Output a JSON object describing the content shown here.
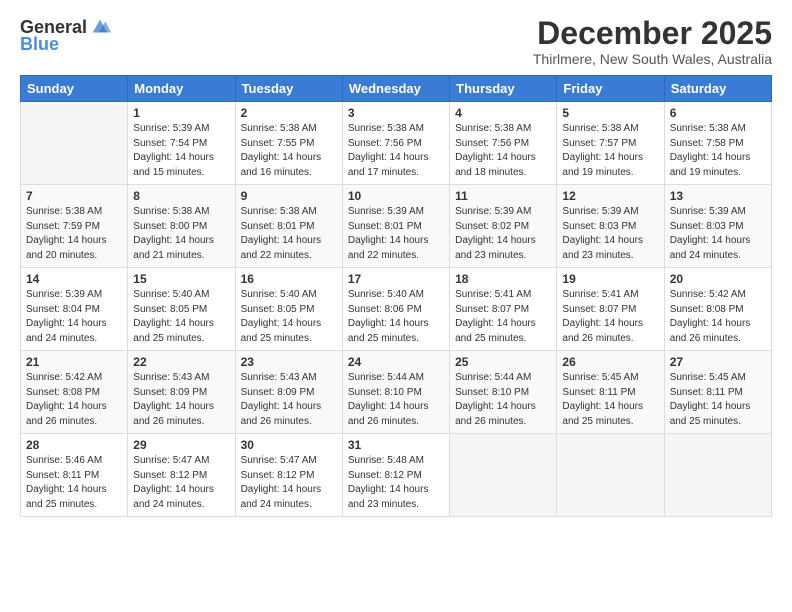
{
  "logo": {
    "general": "General",
    "blue": "Blue"
  },
  "header": {
    "month": "December 2025",
    "location": "Thirlmere, New South Wales, Australia"
  },
  "weekdays": [
    "Sunday",
    "Monday",
    "Tuesday",
    "Wednesday",
    "Thursday",
    "Friday",
    "Saturday"
  ],
  "weeks": [
    [
      {
        "day": "",
        "info": ""
      },
      {
        "day": "1",
        "info": "Sunrise: 5:39 AM\nSunset: 7:54 PM\nDaylight: 14 hours\nand 15 minutes."
      },
      {
        "day": "2",
        "info": "Sunrise: 5:38 AM\nSunset: 7:55 PM\nDaylight: 14 hours\nand 16 minutes."
      },
      {
        "day": "3",
        "info": "Sunrise: 5:38 AM\nSunset: 7:56 PM\nDaylight: 14 hours\nand 17 minutes."
      },
      {
        "day": "4",
        "info": "Sunrise: 5:38 AM\nSunset: 7:56 PM\nDaylight: 14 hours\nand 18 minutes."
      },
      {
        "day": "5",
        "info": "Sunrise: 5:38 AM\nSunset: 7:57 PM\nDaylight: 14 hours\nand 19 minutes."
      },
      {
        "day": "6",
        "info": "Sunrise: 5:38 AM\nSunset: 7:58 PM\nDaylight: 14 hours\nand 19 minutes."
      }
    ],
    [
      {
        "day": "7",
        "info": "Sunrise: 5:38 AM\nSunset: 7:59 PM\nDaylight: 14 hours\nand 20 minutes."
      },
      {
        "day": "8",
        "info": "Sunrise: 5:38 AM\nSunset: 8:00 PM\nDaylight: 14 hours\nand 21 minutes."
      },
      {
        "day": "9",
        "info": "Sunrise: 5:38 AM\nSunset: 8:01 PM\nDaylight: 14 hours\nand 22 minutes."
      },
      {
        "day": "10",
        "info": "Sunrise: 5:39 AM\nSunset: 8:01 PM\nDaylight: 14 hours\nand 22 minutes."
      },
      {
        "day": "11",
        "info": "Sunrise: 5:39 AM\nSunset: 8:02 PM\nDaylight: 14 hours\nand 23 minutes."
      },
      {
        "day": "12",
        "info": "Sunrise: 5:39 AM\nSunset: 8:03 PM\nDaylight: 14 hours\nand 23 minutes."
      },
      {
        "day": "13",
        "info": "Sunrise: 5:39 AM\nSunset: 8:03 PM\nDaylight: 14 hours\nand 24 minutes."
      }
    ],
    [
      {
        "day": "14",
        "info": "Sunrise: 5:39 AM\nSunset: 8:04 PM\nDaylight: 14 hours\nand 24 minutes."
      },
      {
        "day": "15",
        "info": "Sunrise: 5:40 AM\nSunset: 8:05 PM\nDaylight: 14 hours\nand 25 minutes."
      },
      {
        "day": "16",
        "info": "Sunrise: 5:40 AM\nSunset: 8:05 PM\nDaylight: 14 hours\nand 25 minutes."
      },
      {
        "day": "17",
        "info": "Sunrise: 5:40 AM\nSunset: 8:06 PM\nDaylight: 14 hours\nand 25 minutes."
      },
      {
        "day": "18",
        "info": "Sunrise: 5:41 AM\nSunset: 8:07 PM\nDaylight: 14 hours\nand 25 minutes."
      },
      {
        "day": "19",
        "info": "Sunrise: 5:41 AM\nSunset: 8:07 PM\nDaylight: 14 hours\nand 26 minutes."
      },
      {
        "day": "20",
        "info": "Sunrise: 5:42 AM\nSunset: 8:08 PM\nDaylight: 14 hours\nand 26 minutes."
      }
    ],
    [
      {
        "day": "21",
        "info": "Sunrise: 5:42 AM\nSunset: 8:08 PM\nDaylight: 14 hours\nand 26 minutes."
      },
      {
        "day": "22",
        "info": "Sunrise: 5:43 AM\nSunset: 8:09 PM\nDaylight: 14 hours\nand 26 minutes."
      },
      {
        "day": "23",
        "info": "Sunrise: 5:43 AM\nSunset: 8:09 PM\nDaylight: 14 hours\nand 26 minutes."
      },
      {
        "day": "24",
        "info": "Sunrise: 5:44 AM\nSunset: 8:10 PM\nDaylight: 14 hours\nand 26 minutes."
      },
      {
        "day": "25",
        "info": "Sunrise: 5:44 AM\nSunset: 8:10 PM\nDaylight: 14 hours\nand 26 minutes."
      },
      {
        "day": "26",
        "info": "Sunrise: 5:45 AM\nSunset: 8:11 PM\nDaylight: 14 hours\nand 25 minutes."
      },
      {
        "day": "27",
        "info": "Sunrise: 5:45 AM\nSunset: 8:11 PM\nDaylight: 14 hours\nand 25 minutes."
      }
    ],
    [
      {
        "day": "28",
        "info": "Sunrise: 5:46 AM\nSunset: 8:11 PM\nDaylight: 14 hours\nand 25 minutes."
      },
      {
        "day": "29",
        "info": "Sunrise: 5:47 AM\nSunset: 8:12 PM\nDaylight: 14 hours\nand 24 minutes."
      },
      {
        "day": "30",
        "info": "Sunrise: 5:47 AM\nSunset: 8:12 PM\nDaylight: 14 hours\nand 24 minutes."
      },
      {
        "day": "31",
        "info": "Sunrise: 5:48 AM\nSunset: 8:12 PM\nDaylight: 14 hours\nand 23 minutes."
      },
      {
        "day": "",
        "info": ""
      },
      {
        "day": "",
        "info": ""
      },
      {
        "day": "",
        "info": ""
      }
    ]
  ]
}
